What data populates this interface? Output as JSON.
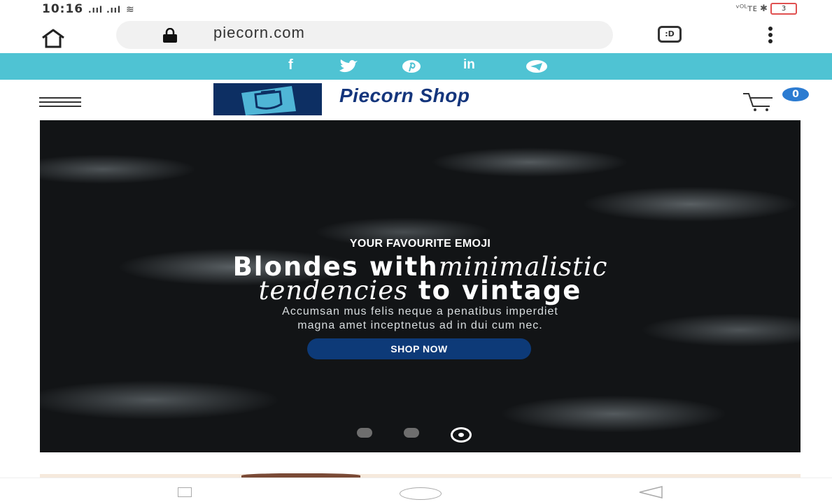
{
  "status_bar": {
    "time": "10:16",
    "signal": ".ııl .ııl",
    "right_icons": "ᵛᴼᴸᴛᴇ ✱",
    "battery": "3"
  },
  "browser": {
    "url": "piecorn.com",
    "tab_switch_label": ":D"
  },
  "social_links": [
    "f",
    "in"
  ],
  "header": {
    "shop_name": "Piecorn Shop",
    "cart_count": "0"
  },
  "hero": {
    "eyebrow": "YOUR FAVOURITE EMOJI",
    "headline_plain_1": "Blondes with",
    "headline_italic_1": "minimalistic",
    "headline_italic_2": "tendencies",
    "headline_plain_2": " to vintage",
    "description_line1": "Accumsan mus felis neque a penatibus imperdiet",
    "description_line2": "magna amet inceptnetus ad in dui cum nec.",
    "cta_label": "SHOP NOW",
    "slide_count": 3,
    "active_slide": 3
  },
  "colors": {
    "social_bar": "#4fc3d3",
    "brand_navy": "#0d2f63",
    "cta": "#0d3a78",
    "cart_badge": "#2b7bd1"
  }
}
